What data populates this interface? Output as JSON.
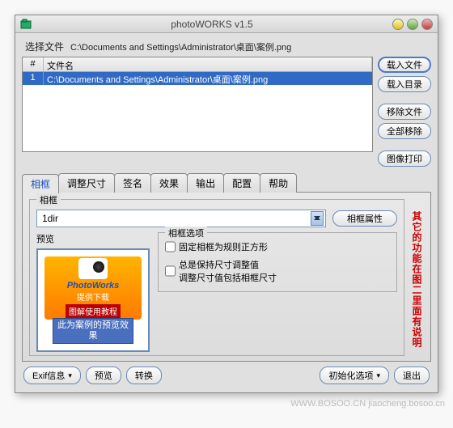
{
  "window": {
    "title": "photoWORKS v1.5"
  },
  "file_label": "选择文件",
  "current_path": "C:\\Documents and Settings\\Administrator\\桌面\\案例.png",
  "table": {
    "cols": [
      "#",
      "文件名"
    ],
    "rows": [
      {
        "num": "1",
        "name": "C:\\Documents and Settings\\Administrator\\桌面\\案例.png"
      }
    ]
  },
  "side": {
    "load_file": "载入文件",
    "load_dir": "载入目录",
    "remove_file": "移除文件",
    "remove_all": "全部移除",
    "print": "图像打印"
  },
  "tabs": [
    "相框",
    "调整尺寸",
    "签名",
    "效果",
    "输出",
    "配置",
    "帮助"
  ],
  "frame": {
    "legend": "相框",
    "select_value": "1dir",
    "prop_btn": "相框属性",
    "preview_label": "预览",
    "options_legend": "相框选项",
    "opt1": "固定相框为规则正方形",
    "opt2a": "总是保持尺寸调整值",
    "opt2b": "调整尺寸值包括相框尺寸",
    "callout": "此为案例的预览效果",
    "logo_name": "PhotoWorks",
    "logo_sub": "提供下载",
    "logo_bar": "图解使用教程"
  },
  "side_note": "其它的功能在图二里面有说明",
  "bottom": {
    "exif": "Exif信息",
    "preview": "预览",
    "convert": "转换",
    "init": "初始化选项",
    "exit": "退出"
  },
  "watermark": "WWW.BOSOO.CN jiaocheng.bosoo.cn"
}
